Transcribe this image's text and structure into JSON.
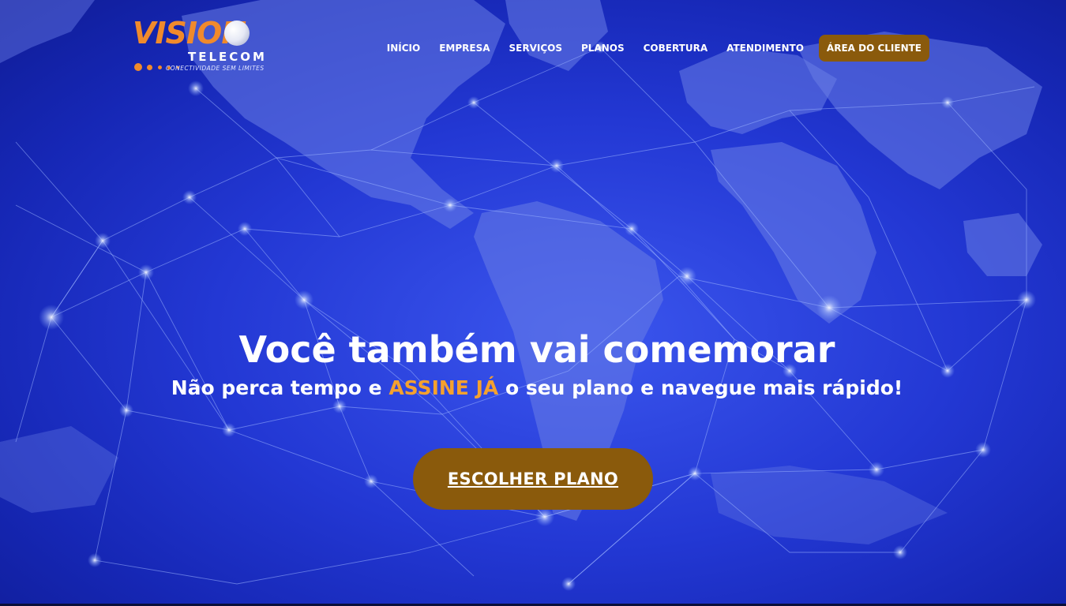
{
  "brand": {
    "logo_word": "VISION",
    "logo_sub": "TELECOM",
    "tagline": "CONECTIVIDADE SEM LIMITES",
    "accent": "#f08a2c"
  },
  "nav": {
    "items": [
      {
        "label": "INÍCIO"
      },
      {
        "label": "EMPRESA"
      },
      {
        "label": "SERVIÇOS"
      },
      {
        "label": "PLANOS"
      },
      {
        "label": "COBERTURA"
      },
      {
        "label": "ATENDIMENTO"
      }
    ],
    "client_area_label": "ÁREA DO CLIENTE",
    "button_color": "#8a5a0c"
  },
  "hero": {
    "headline": "Você também vai comemorar",
    "sub_before": "Não perca tempo e ",
    "sub_highlight": "ASSINE JÁ",
    "sub_after": " o seu plano e navegue mais rápido!",
    "highlight_color": "#f5a12e",
    "cta_label": "ESCOLHER PLANO",
    "background": "blue world map with network lines"
  }
}
